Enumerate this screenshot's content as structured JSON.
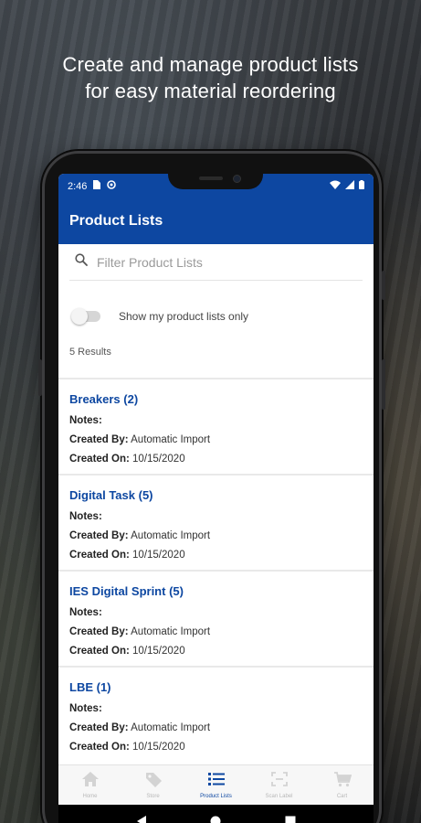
{
  "promo": {
    "line1": "Create and manage product lists",
    "line2": "for easy material reordering"
  },
  "status_bar": {
    "time": "2:46"
  },
  "app_bar": {
    "title": "Product Lists"
  },
  "search": {
    "placeholder": "Filter Product Lists",
    "value": ""
  },
  "filter_toggle": {
    "label": "Show my product lists only",
    "on": false
  },
  "results": {
    "text": "5 Results"
  },
  "product_lists": [
    {
      "title": "Breakers (2)",
      "notes_label": "Notes:",
      "created_by_label": "Created By:",
      "created_by": "Automatic Import",
      "created_on_label": "Created On:",
      "created_on": "10/15/2020"
    },
    {
      "title": "Digital Task (5)",
      "notes_label": "Notes:",
      "created_by_label": "Created By:",
      "created_by": "Automatic Import",
      "created_on_label": "Created On:",
      "created_on": "10/15/2020"
    },
    {
      "title": "IES Digital Sprint (5)",
      "notes_label": "Notes:",
      "created_by_label": "Created By:",
      "created_by": "Automatic Import",
      "created_on_label": "Created On:",
      "created_on": "10/15/2020"
    },
    {
      "title": "LBE (1)",
      "notes_label": "Notes:",
      "created_by_label": "Created By:",
      "created_by": "Automatic Import",
      "created_on_label": "Created On:",
      "created_on": "10/15/2020"
    }
  ],
  "bottom_nav": {
    "items": [
      {
        "label": "Home",
        "icon": "home-icon"
      },
      {
        "label": "Store",
        "icon": "tag-icon"
      },
      {
        "label": "Product Lists",
        "icon": "list-icon",
        "active": true
      },
      {
        "label": "Scan Label",
        "icon": "scan-icon"
      },
      {
        "label": "Cart",
        "icon": "cart-icon"
      }
    ]
  },
  "colors": {
    "primary": "#0d47a1",
    "background": "#ffffff",
    "divider": "#e9e9e9"
  }
}
